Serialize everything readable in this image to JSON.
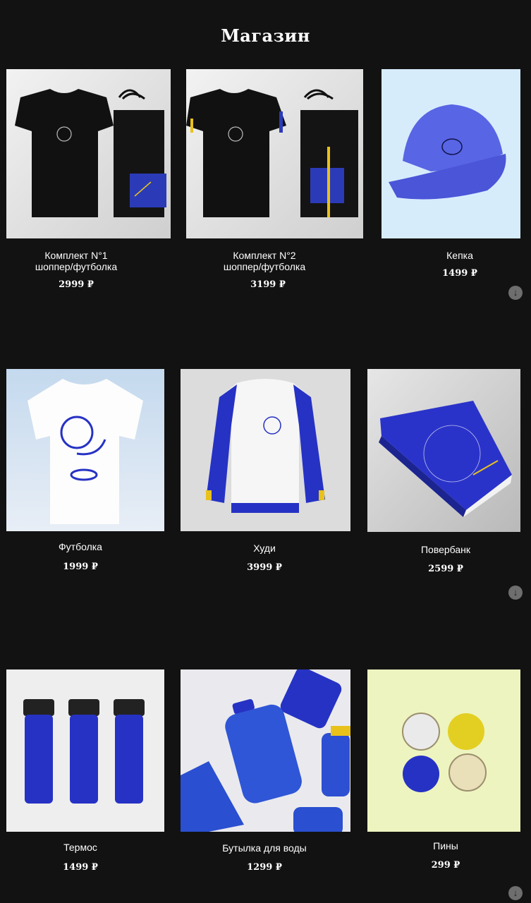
{
  "page": {
    "title": "Магазин"
  },
  "products": [
    {
      "name_line1": "Комплект N°1",
      "name_line2": "шоппер/футболка",
      "price": "2999 ₽"
    },
    {
      "name_line1": "Комплект N°2",
      "name_line2": "шоппер/футболка",
      "price": "3199 ₽"
    },
    {
      "name_line1": "Кепка",
      "name_line2": "",
      "price": "1499 ₽"
    },
    {
      "name_line1": "Футболка",
      "name_line2": "",
      "price": "1999 ₽"
    },
    {
      "name_line1": "Худи",
      "name_line2": "",
      "price": "3999 ₽"
    },
    {
      "name_line1": "Повербанк",
      "name_line2": "",
      "price": "2599 ₽"
    },
    {
      "name_line1": "Термос",
      "name_line2": "",
      "price": "1499 ₽"
    },
    {
      "name_line1": "Бутылка для воды",
      "name_line2": "",
      "price": "1299 ₽"
    },
    {
      "name_line1": "Пины",
      "name_line2": "",
      "price": "299 ₽"
    }
  ],
  "scroll_icon": "arrow-down-icon",
  "colors": {
    "background": "#121212",
    "brand_blue": "#2f3fd6",
    "accent_yellow": "#e8c21a"
  }
}
